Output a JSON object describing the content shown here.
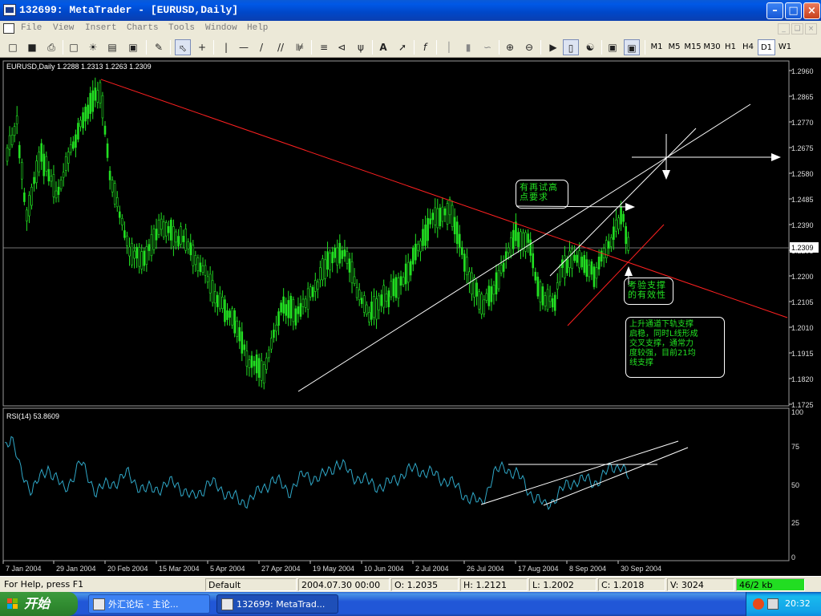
{
  "window": {
    "title": "132699: MetaTrader - [EURUSD,Daily]"
  },
  "menu": {
    "items": [
      "File",
      "View",
      "Insert",
      "Charts",
      "Tools",
      "Window",
      "Help"
    ]
  },
  "toolbar": {
    "timeframes": [
      "M1",
      "M5",
      "M15",
      "M30",
      "H1",
      "H4",
      "D1",
      "W1"
    ],
    "active_timeframe": "D1"
  },
  "chart": {
    "header": "EURUSD,Daily  1.2288 1.2313 1.2263 1.2309",
    "current_price": "1.2309",
    "price_labels": [
      "1.2960",
      "1.2865",
      "1.2770",
      "1.2675",
      "1.2580",
      "1.2485",
      "1.2390",
      "1.2295",
      "1.2200",
      "1.2105",
      "1.2010",
      "1.1915",
      "1.1820",
      "1.1725"
    ],
    "rsi_header": "RSI(14)  53.8609",
    "rsi_labels": [
      "100",
      "75",
      "50",
      "25",
      "0"
    ],
    "date_labels": [
      "7 Jan 2004",
      "29 Jan 2004",
      "20 Feb 2004",
      "15 Mar 2004",
      "5 Apr 2004",
      "27 Apr 2004",
      "19 May 2004",
      "10 Jun 2004",
      "2 Jul 2004",
      "26 Jul 2004",
      "17 Aug 2004",
      "8 Sep 2004",
      "30 Sep 2004"
    ],
    "annotations": [
      {
        "line1": "有再试高",
        "line2": "点要求"
      },
      {
        "line1": "考验支撑",
        "line2": "的有效性"
      },
      {
        "line1": "上升通道下轨支撑",
        "line2": "启稳，同时L线形成",
        "line3": "交叉支撑，通常力",
        "line4": "度较强，目前21均",
        "line5": "线支撑"
      }
    ],
    "colors": {
      "candle": "#22e022",
      "trend_red": "#ff2020",
      "line_white": "#ffffff",
      "rsi": "#2fa8c8",
      "background": "#000000"
    }
  },
  "status": {
    "help": "For Help, press F1",
    "profile": "Default",
    "datetime": "2004.07.30 00:00",
    "open": "O: 1.2035",
    "high": "H: 1.2121",
    "low": "L: 1.2002",
    "close": "C: 1.2018",
    "volume": "V: 3024",
    "traffic": "46/2 kb"
  },
  "taskbar": {
    "start": "开始",
    "tasks": [
      "外汇论坛 - 主论...",
      "132699: MetaTrad..."
    ],
    "clock": "20:32"
  }
}
